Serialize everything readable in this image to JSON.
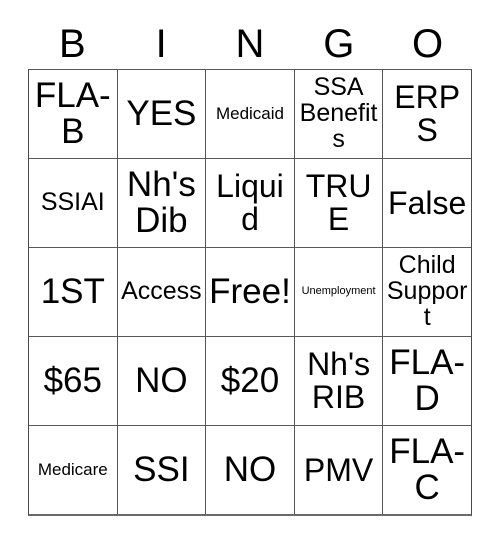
{
  "card": {
    "title": "BINGO",
    "header_letters": [
      "B",
      "I",
      "N",
      "G",
      "O"
    ],
    "text_color": "#000000",
    "background_color": "#ffffff",
    "border_color": "#555555",
    "grid_size": "5x5",
    "free_space": "Free!",
    "rows": [
      [
        {
          "label": "FLA-B",
          "size": "xl"
        },
        {
          "label": "YES",
          "size": "xl"
        },
        {
          "label": "Medicaid",
          "size": "sm"
        },
        {
          "label": "SSA Benefits",
          "size": "md"
        },
        {
          "label": "ERPS",
          "size": "lg"
        }
      ],
      [
        {
          "label": "SSIAI",
          "size": "md"
        },
        {
          "label": "Nh's Dib",
          "size": "xl"
        },
        {
          "label": "Liquid",
          "size": "lg"
        },
        {
          "label": "TRUE",
          "size": "lg"
        },
        {
          "label": "False",
          "size": "lg"
        }
      ],
      [
        {
          "label": "1ST",
          "size": "xl"
        },
        {
          "label": "Access",
          "size": "md"
        },
        {
          "label": "Free!",
          "size": "xl"
        },
        {
          "label": "Unemployment",
          "size": "xs"
        },
        {
          "label": "Child Support",
          "size": "md"
        }
      ],
      [
        {
          "label": "$65",
          "size": "xl"
        },
        {
          "label": "NO",
          "size": "xl"
        },
        {
          "label": "$20",
          "size": "xl"
        },
        {
          "label": "Nh's RIB",
          "size": "lg"
        },
        {
          "label": "FLA-D",
          "size": "xl"
        }
      ],
      [
        {
          "label": "Medicare",
          "size": "sm"
        },
        {
          "label": "SSI",
          "size": "xl"
        },
        {
          "label": "NO",
          "size": "xl"
        },
        {
          "label": "PMV",
          "size": "lg"
        },
        {
          "label": "FLA-C",
          "size": "xl"
        }
      ]
    ]
  }
}
